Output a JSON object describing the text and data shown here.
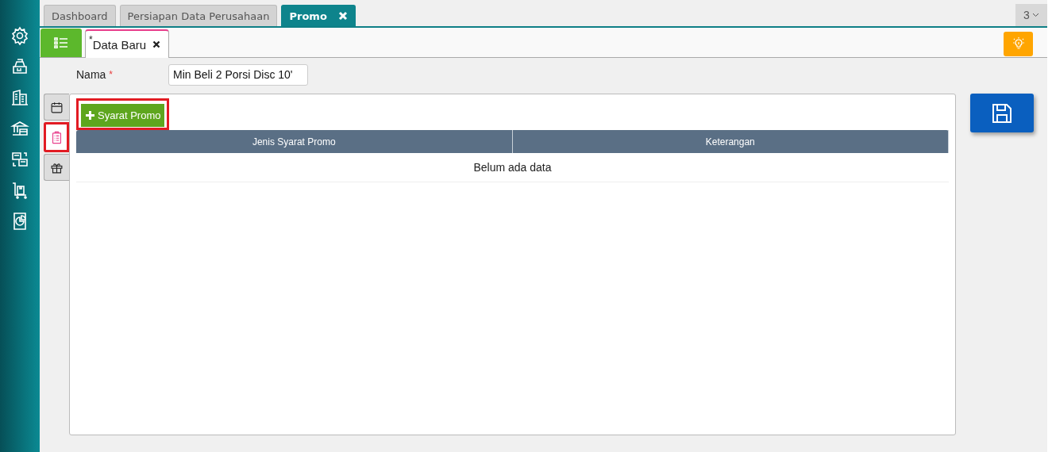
{
  "tabs": [
    {
      "label": "Dashboard",
      "selected": false,
      "closable": false
    },
    {
      "label": "Persiapan Data Perusahaan",
      "selected": false,
      "closable": false
    },
    {
      "label": "Promo",
      "selected": true,
      "closable": true
    }
  ],
  "tab_count": "3",
  "subtabs": [
    {
      "label": "Data Baru",
      "modified": "*",
      "selected": true
    }
  ],
  "form": {
    "label": "Nama",
    "required": true,
    "value": "Min Beli 2 Porsi Disc 10'"
  },
  "side_tabs": [
    {
      "selected": false
    },
    {
      "selected": true
    },
    {
      "selected": false
    }
  ],
  "add_button": "Syarat Promo",
  "table": {
    "columns": [
      "Jenis Syarat Promo",
      "Keterangan"
    ],
    "empty_text": "Belum ada data"
  }
}
